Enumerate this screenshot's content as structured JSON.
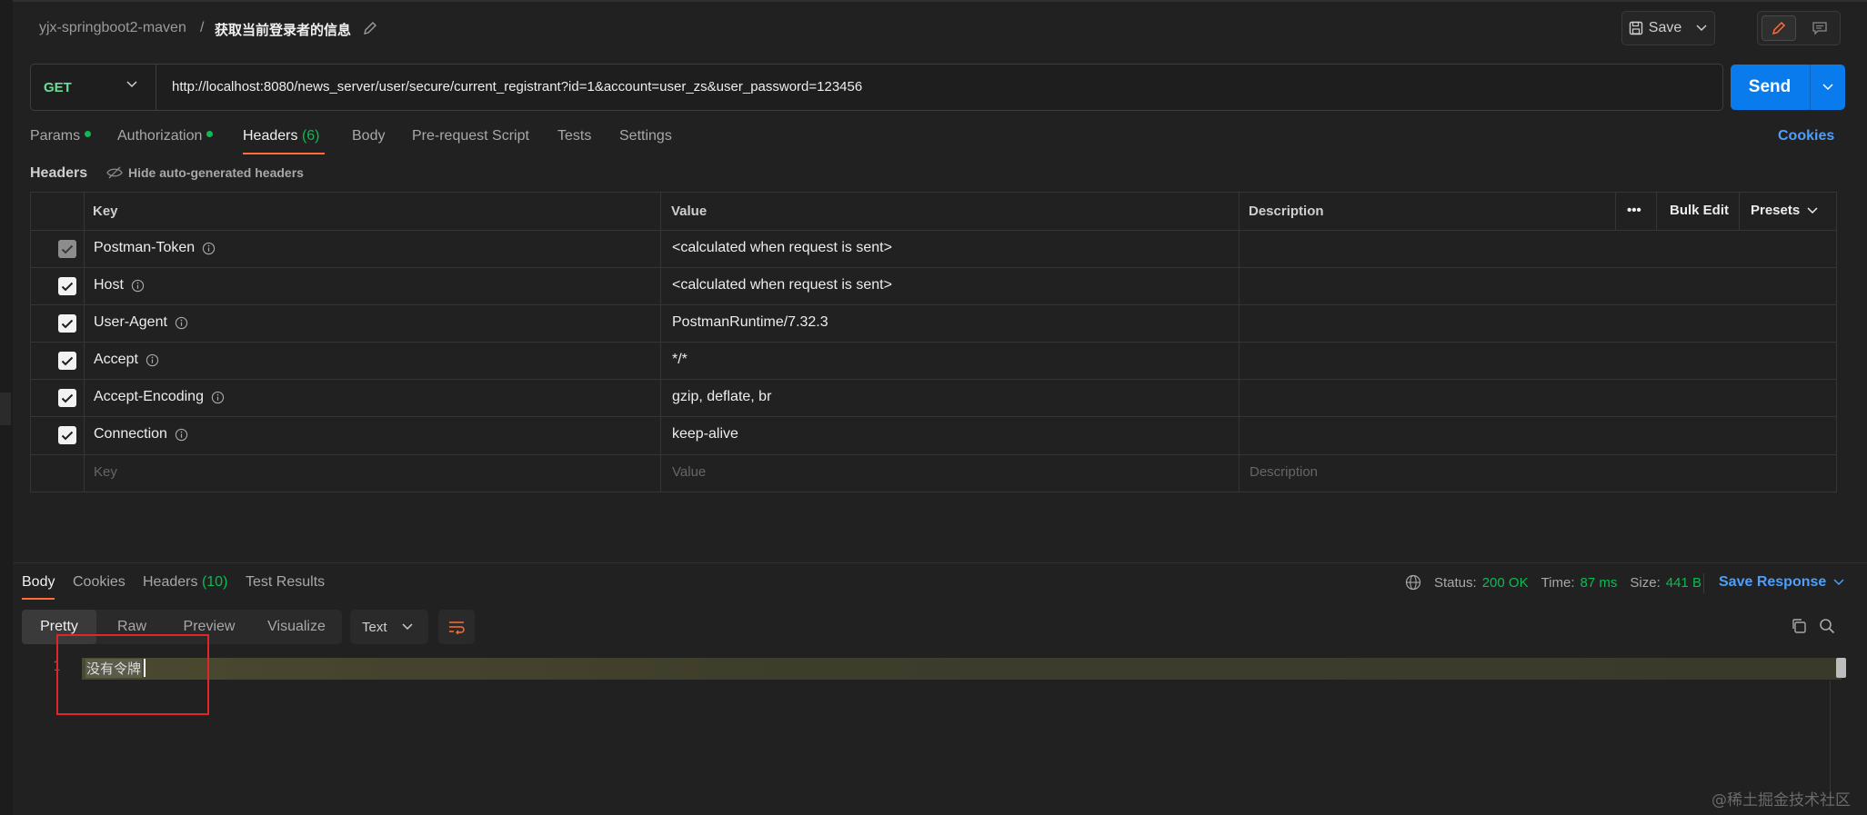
{
  "header": {
    "collection": "yjx-springboot2-maven",
    "separator": "/",
    "request_name": "获取当前登录者的信息",
    "save_label": "Save"
  },
  "request": {
    "method": "GET",
    "url": "http://localhost:8080/news_server/user/secure/current_registrant?id=1&account=user_zs&user_password=123456",
    "send_label": "Send"
  },
  "request_tabs": {
    "params": "Params",
    "authorization": "Authorization",
    "headers": "Headers",
    "headers_count": "(6)",
    "body": "Body",
    "pre_request": "Pre-request Script",
    "tests": "Tests",
    "settings": "Settings",
    "cookies": "Cookies"
  },
  "headers_section": {
    "title": "Headers",
    "hide_auto": "Hide auto-generated headers",
    "columns": {
      "key": "Key",
      "value": "Value",
      "description": "Description"
    },
    "more": "•••",
    "bulk_edit": "Bulk Edit",
    "presets": "Presets",
    "rows": [
      {
        "key": "Postman-Token",
        "value": "<calculated when request is sent>",
        "checked": true
      },
      {
        "key": "Host",
        "value": "<calculated when request is sent>",
        "checked": true
      },
      {
        "key": "User-Agent",
        "value": "PostmanRuntime/7.32.3",
        "checked": true
      },
      {
        "key": "Accept",
        "value": "*/*",
        "checked": true
      },
      {
        "key": "Accept-Encoding",
        "value": "gzip, deflate, br",
        "checked": true
      },
      {
        "key": "Connection",
        "value": "keep-alive",
        "checked": true
      }
    ],
    "placeholders": {
      "key": "Key",
      "value": "Value",
      "description": "Description"
    }
  },
  "response": {
    "tabs": {
      "body": "Body",
      "cookies": "Cookies",
      "headers": "Headers",
      "headers_count": "(10)",
      "test_results": "Test Results"
    },
    "status_label": "Status:",
    "status_value": "200 OK",
    "time_label": "Time:",
    "time_value": "87 ms",
    "size_label": "Size:",
    "size_value": "441 B",
    "save_response": "Save Response",
    "formats": {
      "pretty": "Pretty",
      "raw": "Raw",
      "preview": "Preview",
      "visualize": "Visualize"
    },
    "language": "Text",
    "line_number": "1",
    "content": "没有令牌"
  },
  "watermark": "@稀土掘金技术社区",
  "colors": {
    "accent_orange": "#ff6c37",
    "send_blue": "#097bed",
    "status_green": "#0cbb52",
    "method_green": "#6bdd9a",
    "highlight_red": "#e0262a"
  }
}
